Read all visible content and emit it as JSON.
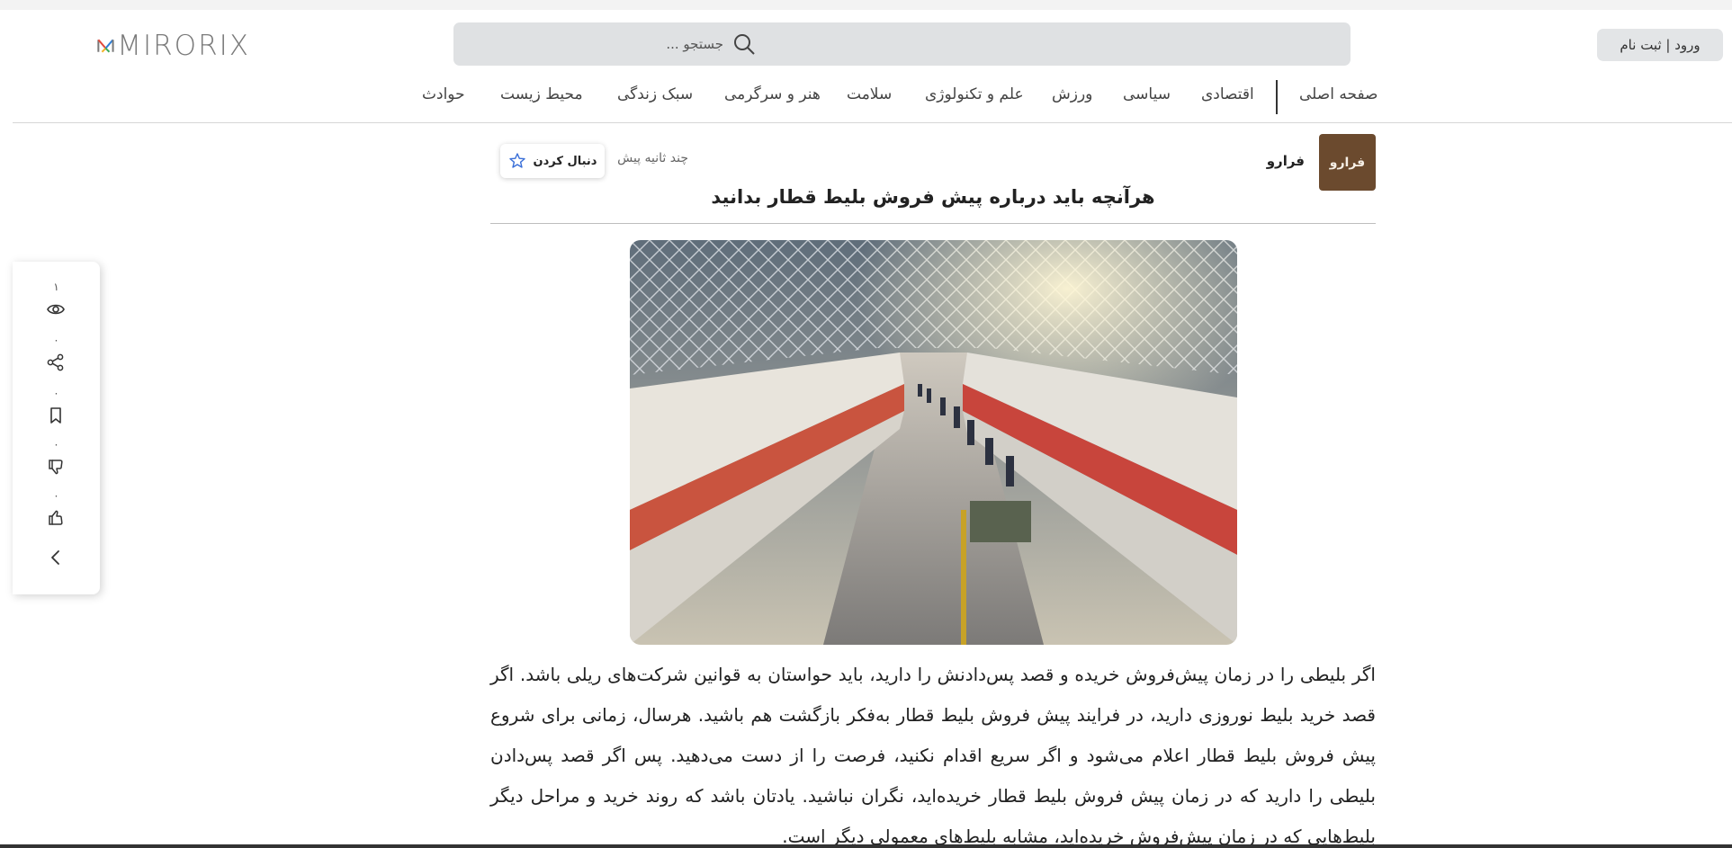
{
  "header": {
    "logo_text": "MIRORIX",
    "search": {
      "placeholder": "جستجو ..."
    },
    "login_label": "ورود | ثبت نام"
  },
  "nav": {
    "items": [
      {
        "label": "صفحه اصلی"
      },
      {
        "label": "اقتصادی"
      },
      {
        "label": "سیاسی"
      },
      {
        "label": "ورزش"
      },
      {
        "label": "علم و تکنولوژی"
      },
      {
        "label": "سلامت"
      },
      {
        "label": "هنر و سرگرمی"
      },
      {
        "label": "سبک زندگی"
      },
      {
        "label": "محیط زیست"
      },
      {
        "label": "حوادث"
      }
    ]
  },
  "side_panel": {
    "views_count": "۱",
    "shares_count": "۰",
    "bookmarks_count": "۰",
    "dislikes_count": "۰",
    "likes_count": "۰"
  },
  "article": {
    "source_name": "فرارو",
    "source_logo_text": "فرارو",
    "time_ago": "چند ثانیه پیش",
    "follow_label": "دنبال کردن",
    "title": "هرآنچه باید درباره پیش فروش بلیط قطار بدانید",
    "body": "اگر بلیطی را در زمان پیش‌فروش خریده و قصد پس‌دادنش را دارید، باید حواستان به قوانین شرکت‌های ریلی باشد. اگر قصد خرید بلیط نوروزی دارید، در فرایند پیش فروش بلیط قطار به‌فکر بازگشت هم باشید. هرسال، زمانی برای شروع پیش فروش بلیط قطار اعلام می‌شود و اگر سریع اقدام نکنید، فرصت را از دست می‌دهید. پس اگر قصد پس‌دادن بلیطی را دارید که در زمان پیش فروش بلیط قطار خریده‌اید، نگران نباشید. یادتان باشد که روند خرید و مراحل دیگر بلیط‌هایی که در زمان پیش‌فروش خریده‌اید، مشابه بلیط‌های معمولی دیگر است."
  },
  "colors": {
    "search_bg": "#dfe1e3",
    "source_avatar_bg": "#6b4a2e",
    "star_blue": "#3a6fd8"
  }
}
